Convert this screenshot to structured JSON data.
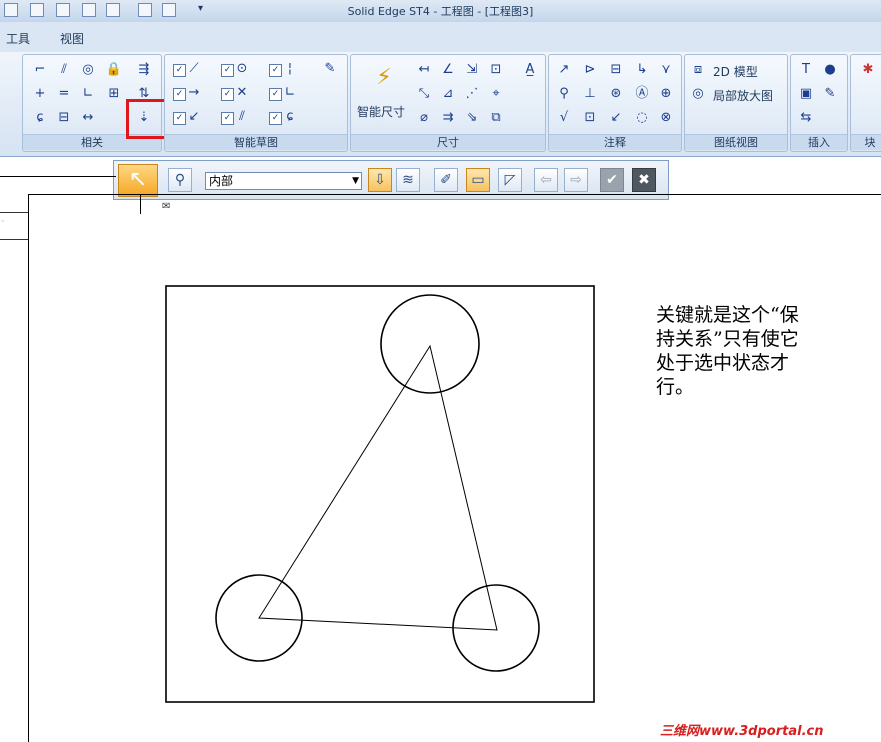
{
  "window": {
    "title": "Solid Edge ST4 - 工程图 - [工程图3]"
  },
  "menu": {
    "tools": "工具",
    "view": "视图"
  },
  "ribbon": {
    "groups": {
      "relate": "相关",
      "smart_sketch": "智能草图",
      "dimension": "尺寸",
      "annotation": "注释",
      "drawing_view": "图纸视图",
      "insert": "插入",
      "cut": "块"
    },
    "smart_dimension_label": "智能尺寸",
    "model_2d_label": "2D 模型",
    "detail_view_label": "局部放大图",
    "maintain_relationships_highlighted": true
  },
  "command_bar": {
    "select_filter_value": "内部"
  },
  "annotation_text": "关键就是这个“保持关系”只有使它处于选中状态才行。",
  "watermark": "三维网www.3dportal.cn",
  "colors": {
    "highlight": "#e0161b",
    "accent": "#f5a623"
  }
}
